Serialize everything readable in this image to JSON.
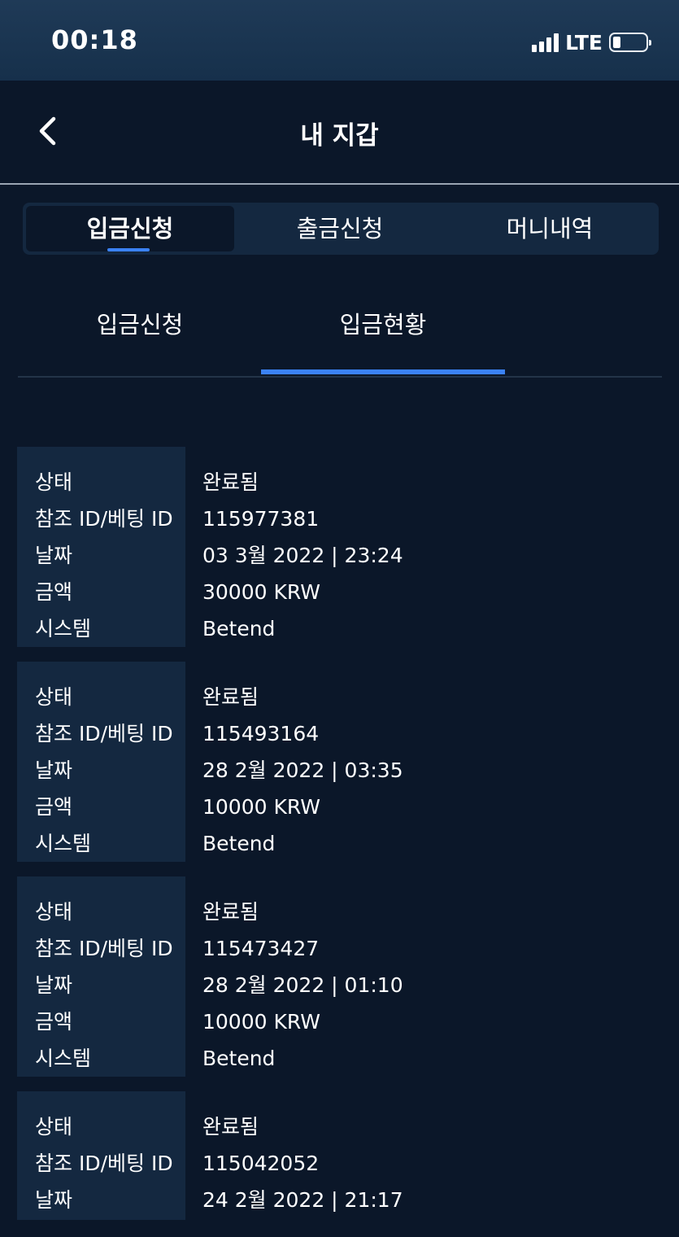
{
  "status_bar": {
    "time": "00:18",
    "network": "LTE",
    "signal_icon": "signal-bars-icon",
    "battery_icon": "battery-icon"
  },
  "header": {
    "title": "내 지갑",
    "back_icon": "chevron-left-icon"
  },
  "main_tabs": [
    {
      "label": "입금신청",
      "active": true
    },
    {
      "label": "출금신청",
      "active": false
    },
    {
      "label": "머니내역",
      "active": false
    }
  ],
  "sub_tabs": [
    {
      "label": "입금신청",
      "active": false
    },
    {
      "label": "입금현황",
      "active": true
    }
  ],
  "field_labels": {
    "status": "상태",
    "ref_id": "참조 ID/베팅 ID",
    "date": "날짜",
    "amount": "금액",
    "system": "시스템"
  },
  "records": [
    {
      "status": "완료됨",
      "ref_id": "115977381",
      "date": "03 3월 2022 | 23:24",
      "amount": "30000 KRW",
      "system": "Betend"
    },
    {
      "status": "완료됨",
      "ref_id": "115493164",
      "date": "28 2월 2022 | 03:35",
      "amount": "10000 KRW",
      "system": "Betend"
    },
    {
      "status": "완료됨",
      "ref_id": "115473427",
      "date": "28 2월 2022 | 01:10",
      "amount": "10000 KRW",
      "system": "Betend"
    },
    {
      "status": "완료됨",
      "ref_id": "115042052",
      "date": "24 2월 2022 | 21:17"
    }
  ],
  "colors": {
    "background": "#0b1729",
    "panel": "#142840",
    "accent": "#3b82f6"
  }
}
